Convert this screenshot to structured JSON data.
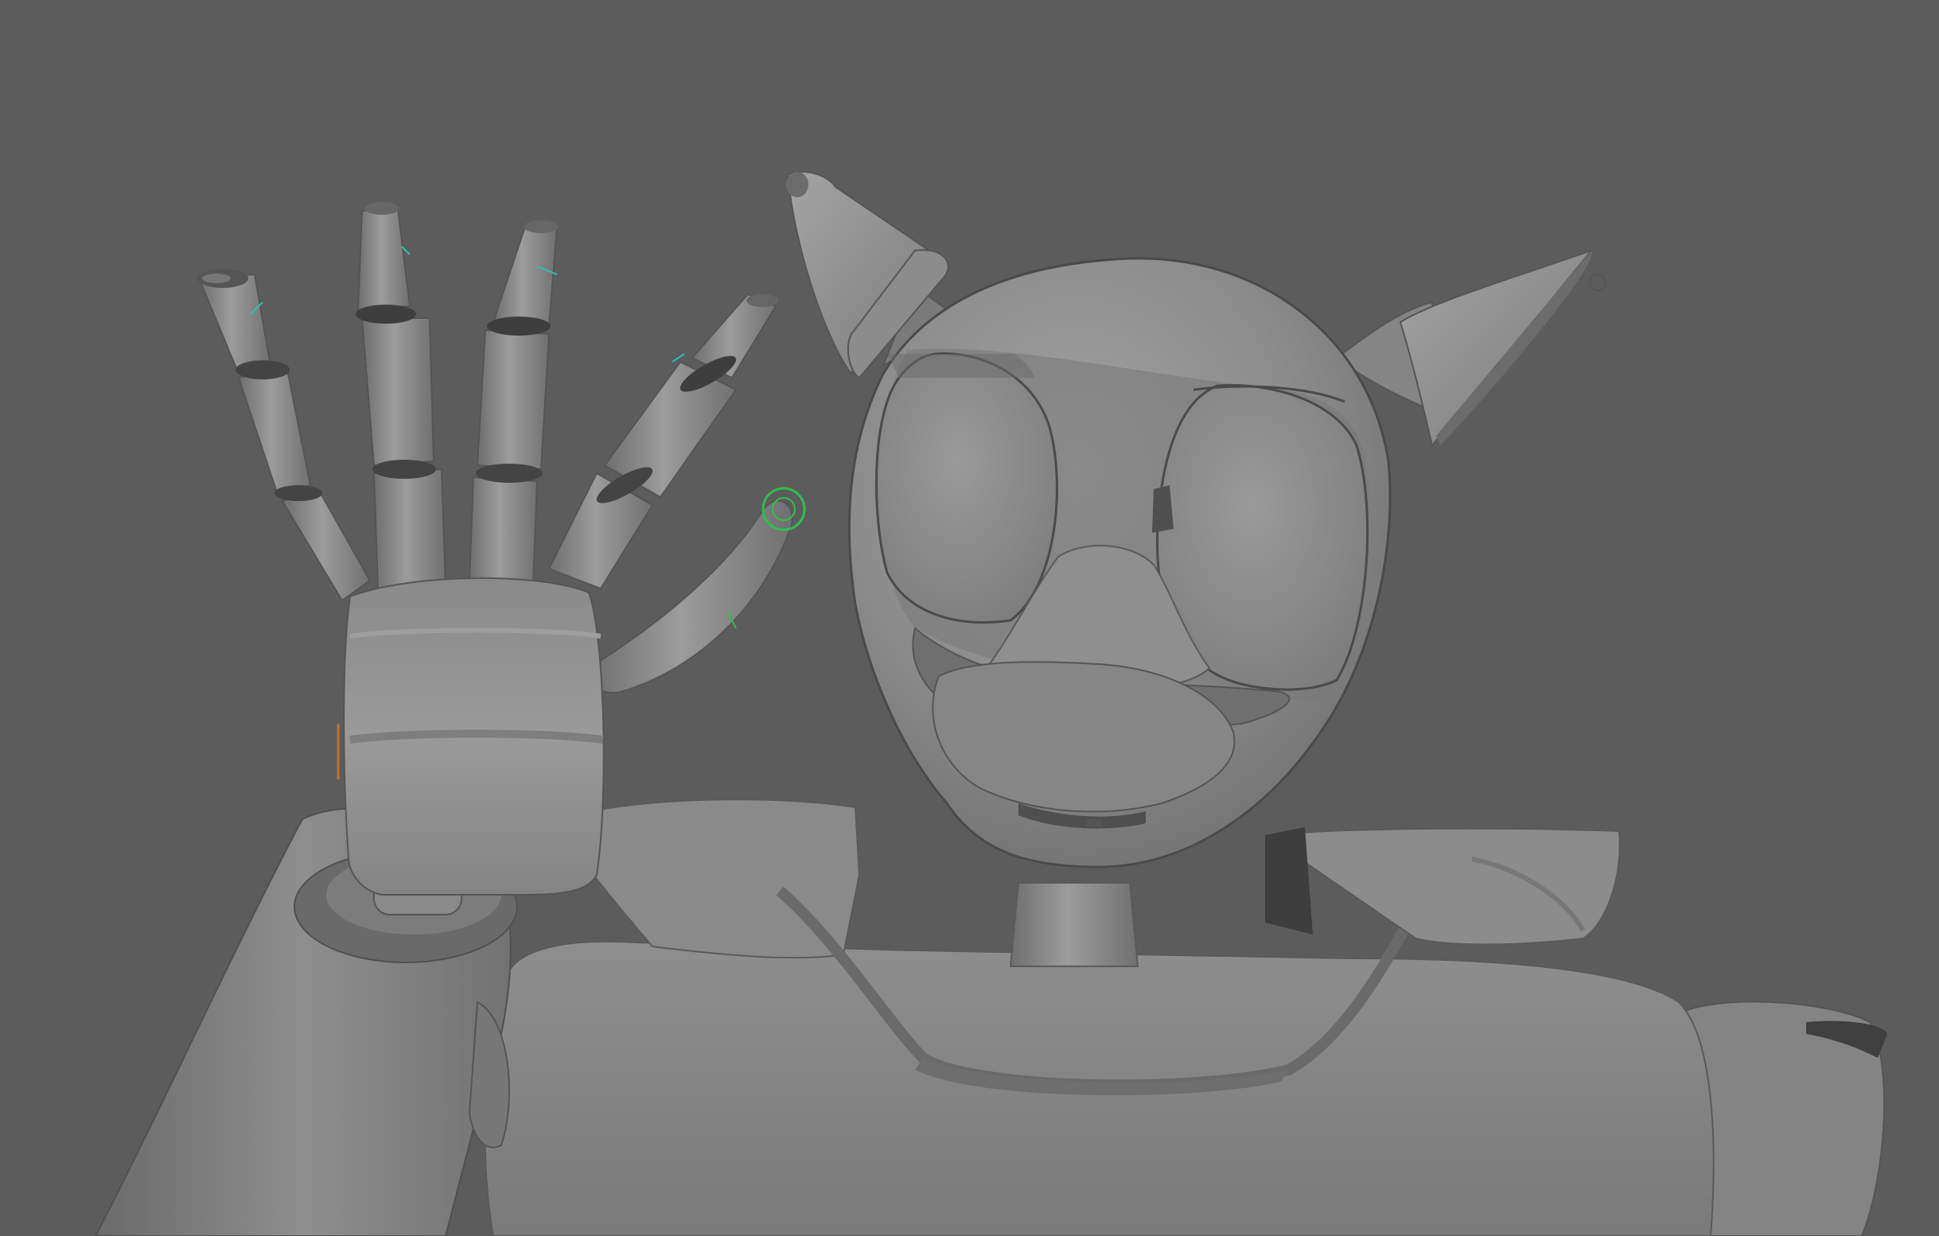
{
  "app": {
    "view": "perspective-viewport",
    "display_mode": "smooth-shaded",
    "background_color": "#5c5c5c"
  },
  "scene": {
    "subject": "robot-animatronic-model",
    "parts": [
      "head",
      "ears",
      "eyes",
      "snout",
      "jaw",
      "neck",
      "torso",
      "collar",
      "raised-arm",
      "hand",
      "fingers",
      "thumb",
      "right-shoulder"
    ],
    "surface_color": "#8a8a8a",
    "shadow_color": "#5f5f5f",
    "highlight_color": "#a6a6a6",
    "rig_controls": [
      {
        "name": "thumb-ik-control",
        "color": "#2fbf4f"
      },
      {
        "name": "finger-joint-markers",
        "color": "#2fbfb0"
      }
    ]
  }
}
